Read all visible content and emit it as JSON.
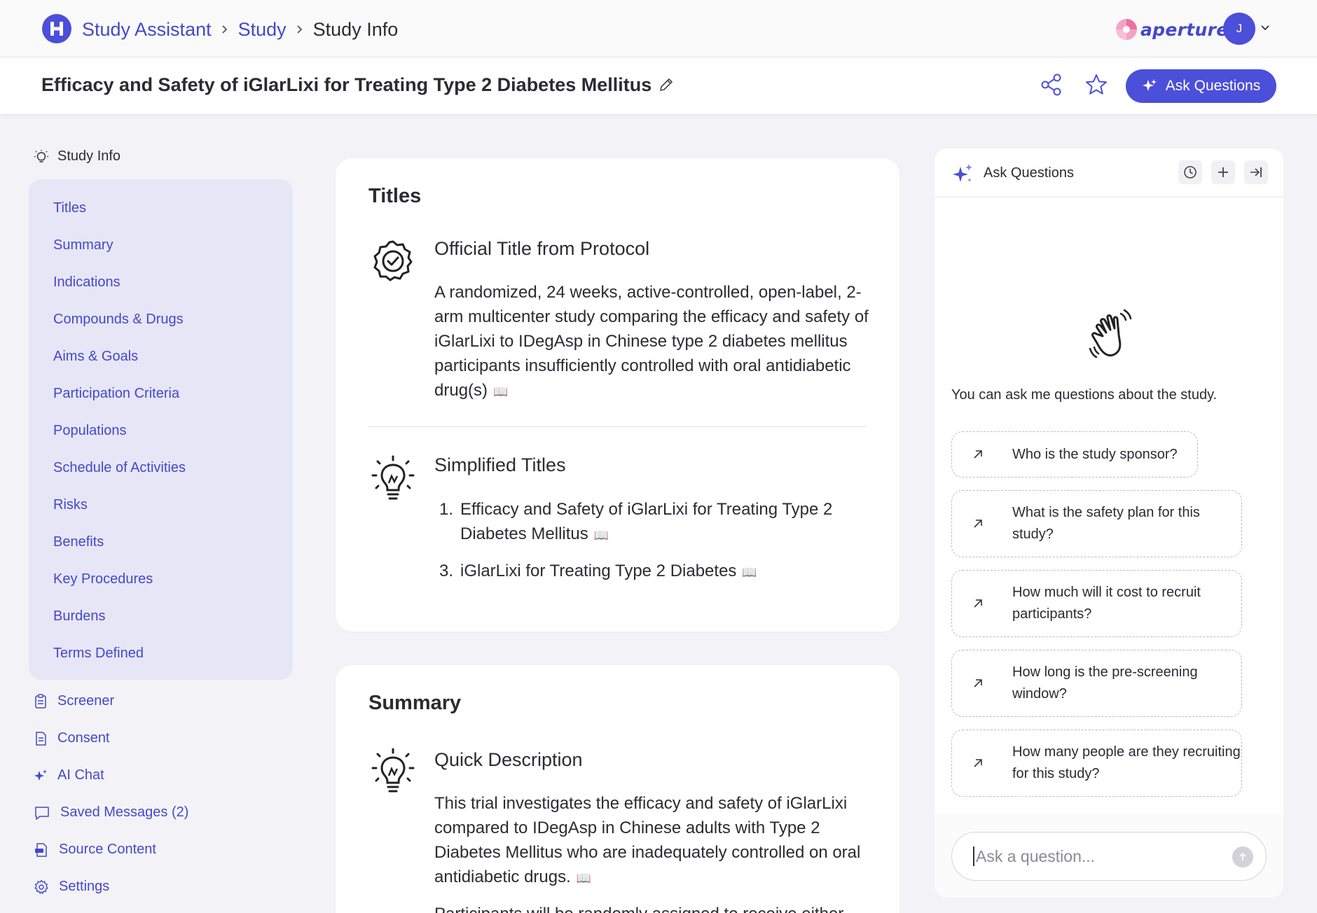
{
  "header": {
    "breadcrumbs": [
      "Study Assistant",
      "Study",
      "Study Info"
    ],
    "brand": "aperture",
    "avatar_initial": "J"
  },
  "study": {
    "title": "Efficacy and Safety of iGlarLixi for Treating Type 2 Diabetes Mellitus",
    "ask_button": "Ask Questions"
  },
  "sidebar": {
    "heading": "Study Info",
    "sections": [
      "Titles",
      "Summary",
      "Indications",
      "Compounds & Drugs",
      "Aims & Goals",
      "Participation Criteria",
      "Populations",
      "Schedule of Activities",
      "Risks",
      "Benefits",
      "Key Procedures",
      "Burdens",
      "Terms Defined"
    ],
    "links": [
      "Screener",
      "Consent",
      "AI Chat",
      "Saved Messages (2)",
      "Source Content",
      "Settings"
    ]
  },
  "titles_card": {
    "heading": "Titles",
    "official_heading": "Official Title from Protocol",
    "official_text": "A randomized, 24 weeks, active-controlled, open-label, 2-arm multicenter study comparing the efficacy and safety of iGlarLixi to IDegAsp in Chinese type 2 diabetes mellitus participants insufficiently controlled with oral antidiabetic drug(s)",
    "simplified_heading": "Simplified Titles",
    "simplified": [
      {
        "num": "1.",
        "text": "Efficacy and Safety of iGlarLixi for Treating Type 2 Diabetes Mellitus"
      },
      {
        "num": "3.",
        "text": "iGlarLixi for Treating Type 2 Diabetes"
      }
    ],
    "book_glyph": "📖"
  },
  "summary_card": {
    "heading": "Summary",
    "quick_heading": "Quick Description",
    "quick_text": "This trial investigates the efficacy and safety of iGlarLixi compared to IDegAsp in Chinese adults with Type 2 Diabetes Mellitus who are inadequately controlled on oral antidiabetic drugs.",
    "next_text": "Participants will be randomly assigned to receive either"
  },
  "chat": {
    "title": "Ask Questions",
    "intro": "You can ask me questions about the study.",
    "suggestions": [
      "Who is the study sponsor?",
      "What is the safety plan for this study?",
      "How much will it cost to recruit participants?",
      "How long is the pre-screening window?",
      "How many people are they recruiting for this study?"
    ],
    "input_placeholder": "Ask a question..."
  },
  "colors": {
    "accent": "#4b4fd9",
    "link": "#4548c9",
    "sidebar_panel": "#e6e6f6",
    "background": "#f3f3f7"
  }
}
